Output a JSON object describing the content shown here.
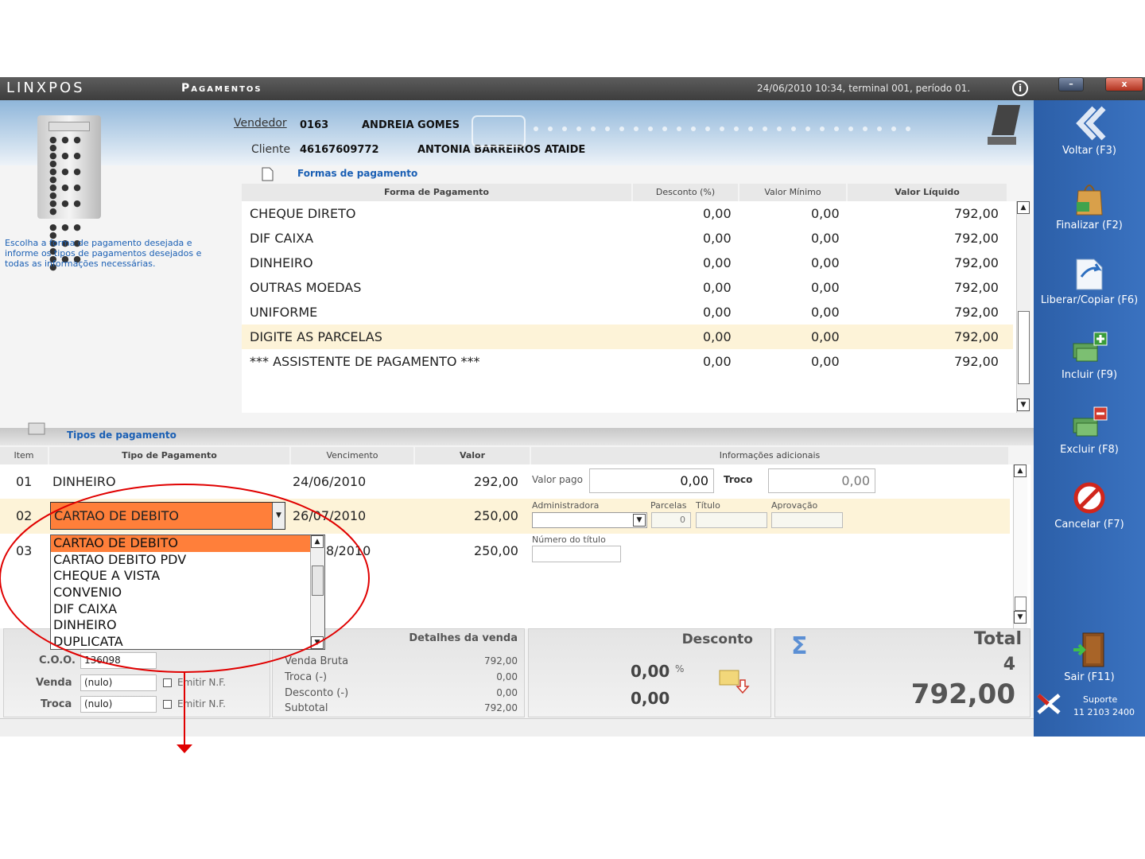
{
  "app": {
    "logo": "LINXPOS",
    "title": "Pagamentos",
    "datetime": "24/06/2010 10:34, terminal 001, período 01.",
    "info_icon": "i",
    "minimize": "–",
    "close": "x"
  },
  "header": {
    "vendedor_label": "Vendedor",
    "vendedor_code": "0163",
    "vendedor_name": "ANDREIA GOMES",
    "cliente_label": "Cliente",
    "cliente_code": "46167609772",
    "cliente_name": "ANTONIA BARREIROS ATAIDE"
  },
  "help_text": "Escolha a forma de pagamento desejada e informe os tipos de pagamentos desejados e todas as informações necessárias.",
  "forms": {
    "title": "Formas de pagamento",
    "columns": [
      "Forma de Pagamento",
      "Desconto (%)",
      "Valor Mínimo",
      "Valor Líquido"
    ],
    "rows": [
      {
        "name": "CHEQUE DIRETO",
        "desc": "0,00",
        "min": "0,00",
        "liq": "792,00"
      },
      {
        "name": "DIF CAIXA",
        "desc": "0,00",
        "min": "0,00",
        "liq": "792,00"
      },
      {
        "name": "DINHEIRO",
        "desc": "0,00",
        "min": "0,00",
        "liq": "792,00"
      },
      {
        "name": "OUTRAS MOEDAS",
        "desc": "0,00",
        "min": "0,00",
        "liq": "792,00"
      },
      {
        "name": "UNIFORME",
        "desc": "0,00",
        "min": "0,00",
        "liq": "792,00"
      },
      {
        "name": "DIGITE AS PARCELAS",
        "desc": "0,00",
        "min": "0,00",
        "liq": "792,00"
      },
      {
        "name": "*** ASSISTENTE DE PAGAMENTO ***",
        "desc": "0,00",
        "min": "0,00",
        "liq": "792,00"
      }
    ]
  },
  "payments": {
    "title": "Tipos de pagamento",
    "columns": [
      "Item",
      "Tipo de Pagamento",
      "Vencimento",
      "Valor",
      "Informações adicionais"
    ],
    "rows": [
      {
        "item": "01",
        "tipo": "DINHEIRO",
        "venc": "24/06/2010",
        "valor": "292,00"
      },
      {
        "item": "02",
        "tipo": "CARTAO DE DEBITO",
        "venc": "26/07/2010",
        "valor": "250,00"
      },
      {
        "item": "03",
        "tipo": "",
        "venc": "8/2010",
        "valor": "250,00"
      }
    ],
    "valor_pago_label": "Valor pago",
    "valor_pago": "0,00",
    "troco_label": "Troco",
    "troco": "0,00",
    "administradora_label": "Administradora",
    "parcelas_label": "Parcelas",
    "parcelas": "0",
    "titulo_label": "Título",
    "aprovacao_label": "Aprovação",
    "numero_titulo_label": "Número do título"
  },
  "dropdown": {
    "options": [
      "CARTAO DE DEBITO",
      "CARTAO DEBITO PDV",
      "CHEQUE A VISTA",
      "CONVENIO",
      "DIF CAIXA",
      "DINHEIRO",
      "DUPLICATA"
    ],
    "selected": "CARTAO DE DEBITO"
  },
  "bottom": {
    "coo_label": "C.O.O.",
    "coo": "136098",
    "venda_label": "Venda",
    "venda": "(nulo)",
    "troca_label": "Troca",
    "troca": "(nulo)",
    "emitir_nf": "Emitir N.F.",
    "detalhes_title": "Detalhes da venda",
    "detalhes": [
      {
        "label": "Venda Bruta",
        "value": "792,00"
      },
      {
        "label": "Troca (-)",
        "value": "0,00"
      },
      {
        "label": "Desconto (-)",
        "value": "0,00"
      },
      {
        "label": "Subtotal",
        "value": "792,00"
      }
    ],
    "desconto_title": "Desconto",
    "desconto_pct": "0,00",
    "pct_sign": "%",
    "desconto_val": "0,00",
    "total_title": "Total",
    "total_items": "4",
    "total_value": "792,00",
    "sigma": "Σ"
  },
  "sidebar": {
    "buttons": [
      {
        "label": "Voltar (F3)",
        "icon": "back-icon"
      },
      {
        "label": "Finalizar (F2)",
        "icon": "bag-icon"
      },
      {
        "label": "Liberar/Copiar (F6)",
        "icon": "copy-icon"
      },
      {
        "label": "Incluir (F9)",
        "icon": "add-money-icon"
      },
      {
        "label": "Excluir (F8)",
        "icon": "remove-money-icon"
      },
      {
        "label": "Cancelar (F7)",
        "icon": "cancel-icon"
      },
      {
        "label": "Sair (F11)",
        "icon": "door-icon"
      }
    ],
    "support_label": "Suporte",
    "support_phone": "11 2103 2400"
  },
  "colors": {
    "accent": "#ff7f3a",
    "annotation": "#e00000",
    "sidebar": "#3a72c0",
    "link": "#1a5fb4",
    "highlight_row": "#fdf3d8"
  }
}
